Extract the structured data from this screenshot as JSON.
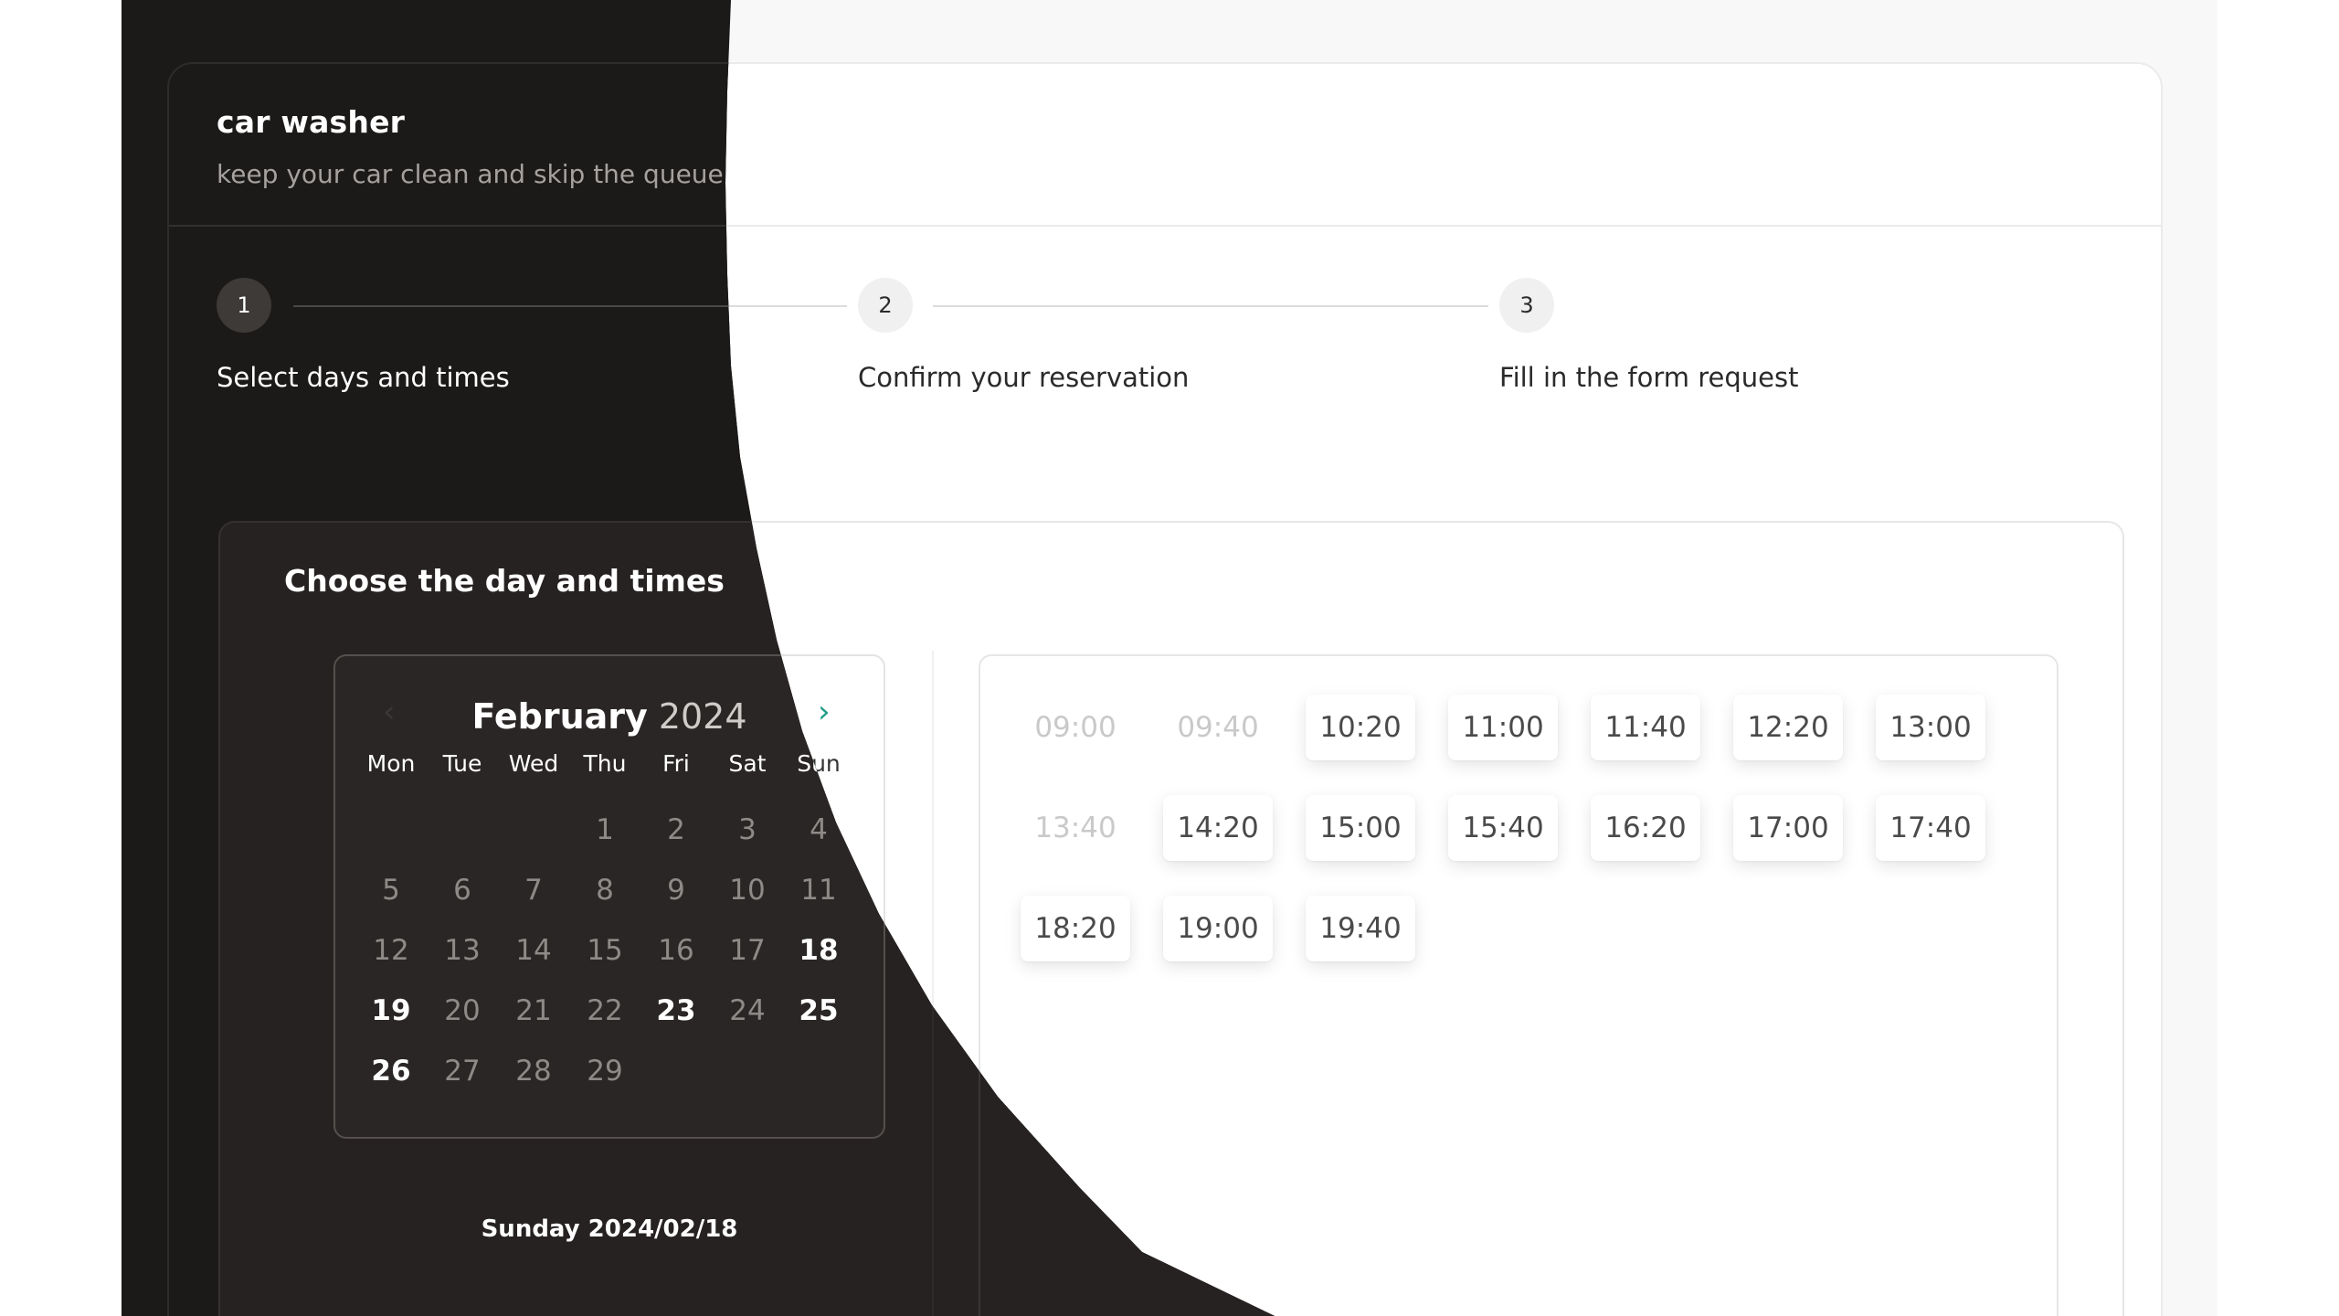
{
  "app": {
    "title": "car washer",
    "subtitle": "keep your car clean and skip the queue"
  },
  "steps": [
    {
      "number": "1",
      "label": "Select days and times"
    },
    {
      "number": "2",
      "label": "Confirm your reservation"
    },
    {
      "number": "3",
      "label": "Fill in the form request"
    }
  ],
  "panel": {
    "title": "Choose the day and times"
  },
  "calendar": {
    "month": "February",
    "year": "2024",
    "weekdays": [
      "Mon",
      "Tue",
      "Wed",
      "Thu",
      "Fri",
      "Sat",
      "Sun"
    ],
    "days": [
      {
        "label": "",
        "available": false
      },
      {
        "label": "",
        "available": false
      },
      {
        "label": "",
        "available": false
      },
      {
        "label": "1",
        "available": false
      },
      {
        "label": "2",
        "available": false
      },
      {
        "label": "3",
        "available": false
      },
      {
        "label": "4",
        "available": false
      },
      {
        "label": "5",
        "available": false
      },
      {
        "label": "6",
        "available": false
      },
      {
        "label": "7",
        "available": false
      },
      {
        "label": "8",
        "available": false
      },
      {
        "label": "9",
        "available": false
      },
      {
        "label": "10",
        "available": false
      },
      {
        "label": "11",
        "available": false
      },
      {
        "label": "12",
        "available": false
      },
      {
        "label": "13",
        "available": false
      },
      {
        "label": "14",
        "available": false
      },
      {
        "label": "15",
        "available": false
      },
      {
        "label": "16",
        "available": false
      },
      {
        "label": "17",
        "available": false
      },
      {
        "label": "18",
        "available": true
      },
      {
        "label": "19",
        "available": true
      },
      {
        "label": "20",
        "available": false
      },
      {
        "label": "21",
        "available": false
      },
      {
        "label": "22",
        "available": false
      },
      {
        "label": "23",
        "available": true
      },
      {
        "label": "24",
        "available": false
      },
      {
        "label": "25",
        "available": true
      },
      {
        "label": "26",
        "available": true
      },
      {
        "label": "27",
        "available": false
      },
      {
        "label": "28",
        "available": false
      },
      {
        "label": "29",
        "available": false
      }
    ],
    "selected_date": "Sunday 2024/02/18",
    "prev_icon": "chevron-left-icon",
    "next_icon": "chevron-right-icon"
  },
  "time_slots": [
    {
      "time": "09:00",
      "available": false
    },
    {
      "time": "09:40",
      "available": false
    },
    {
      "time": "10:20",
      "available": true
    },
    {
      "time": "11:00",
      "available": true
    },
    {
      "time": "11:40",
      "available": true
    },
    {
      "time": "12:20",
      "available": true
    },
    {
      "time": "13:00",
      "available": true
    },
    {
      "time": "13:40",
      "available": false
    },
    {
      "time": "14:20",
      "available": true
    },
    {
      "time": "15:00",
      "available": true
    },
    {
      "time": "15:40",
      "available": true
    },
    {
      "time": "16:20",
      "available": true
    },
    {
      "time": "17:00",
      "available": true
    },
    {
      "time": "17:40",
      "available": true
    },
    {
      "time": "18:20",
      "available": true
    },
    {
      "time": "19:00",
      "available": true
    },
    {
      "time": "19:40",
      "available": true
    }
  ],
  "colors": {
    "dark_bg": "#1b1a19",
    "panel_dark": "#262221",
    "accent": "#1f9c86",
    "light_bg": "#ffffff"
  }
}
